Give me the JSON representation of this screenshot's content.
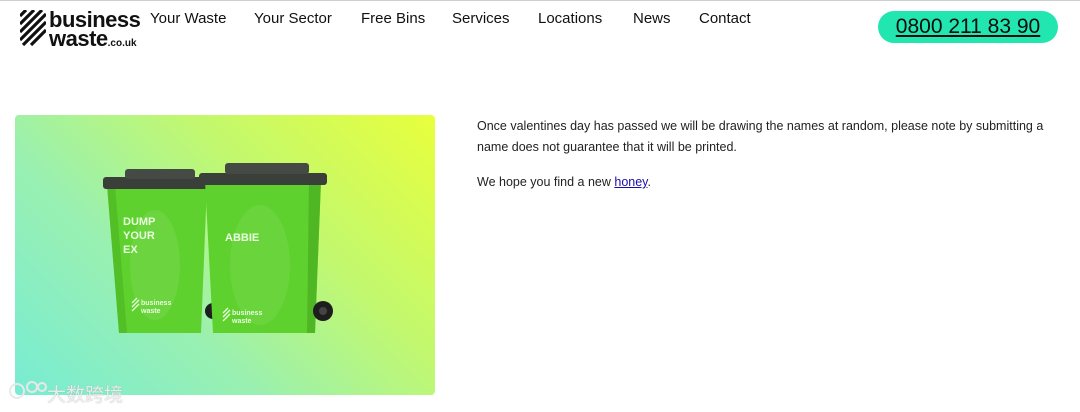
{
  "brand": {
    "line1": "business",
    "line2": "waste",
    "suffix": ".co.uk"
  },
  "nav": {
    "items": [
      {
        "label": "Your Waste"
      },
      {
        "label": "Your Sector"
      },
      {
        "label": "Free Bins"
      },
      {
        "label": "Services"
      },
      {
        "label": "Locations"
      },
      {
        "label": "News"
      },
      {
        "label": "Contact"
      }
    ]
  },
  "phone": "0800 211 83 90",
  "hero": {
    "bin_left_lines": [
      "DUMP",
      "YOUR",
      "EX"
    ],
    "bin_right_label": "ABBIE",
    "bin_brand_line1": "business",
    "bin_brand_line2": "waste",
    "bin_brand_suffix": ".co.uk"
  },
  "content": {
    "paragraph1": "Once valentines day has passed we will be drawing the names at random, please note by submitting a name does not guarantee that it will be printed.",
    "paragraph2_prefix": "We hope you find a new ",
    "paragraph2_link": "honey",
    "paragraph2_suffix": "."
  },
  "watermark": {
    "text": "大数跨境"
  },
  "colors": {
    "accent": "#22e6b0",
    "bin_green": "#5fd12e",
    "lid_dark": "#3a3f3a",
    "link": "#1a0dab"
  }
}
